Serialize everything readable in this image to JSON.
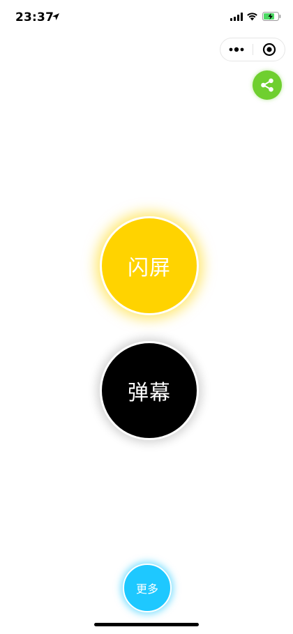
{
  "status_bar": {
    "time": "23:37",
    "icons": [
      "location-arrow-icon",
      "signal-icon",
      "wifi-icon",
      "battery-charging-icon"
    ]
  },
  "capsule": {
    "more_icon": "more-dots-icon",
    "close_icon": "target-close-icon"
  },
  "share": {
    "icon": "share-icon",
    "color": "#6fcf2f"
  },
  "main": {
    "flash_label": "闪屏",
    "flash_color": "#ffd300",
    "danmaku_label": "弹幕",
    "danmaku_color": "#000000"
  },
  "footer": {
    "more_label": "更多",
    "more_color": "#1ec8ff"
  }
}
